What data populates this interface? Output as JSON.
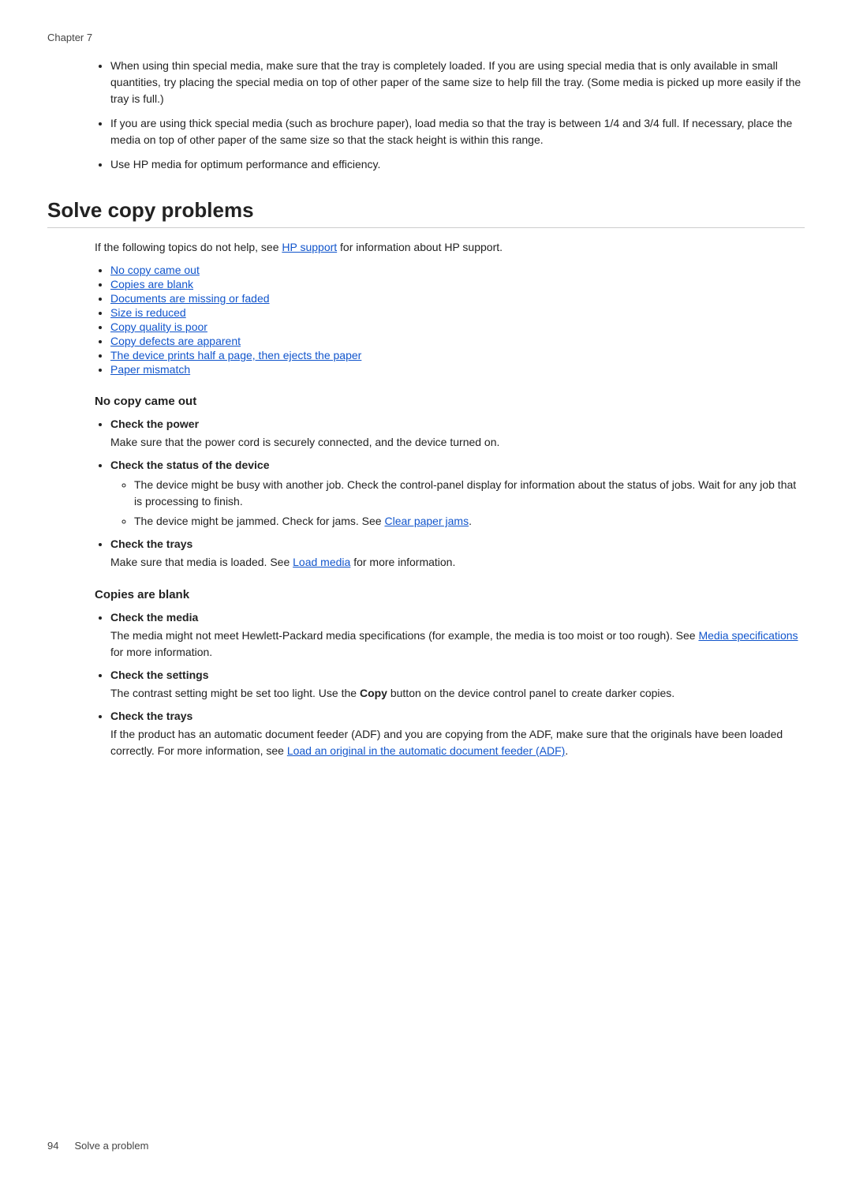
{
  "chapter": "Chapter 7",
  "intro_bullets": [
    "When using thin special media, make sure that the tray is completely loaded. If you are using special media that is only available in small quantities, try placing the special media on top of other paper of the same size to help fill the tray. (Some media is picked up more easily if the tray is full.)",
    "If you are using thick special media (such as brochure paper), load media so that the tray is between 1/4 and 3/4 full. If necessary, place the media on top of other paper of the same size so that the stack height is within this range.",
    "Use HP media for optimum performance and efficiency."
  ],
  "section_title": "Solve copy problems",
  "intro_text": "If the following topics do not help, see",
  "hp_support_link": "HP support",
  "intro_text2": "for information about HP support.",
  "toc_items": [
    {
      "label": "No copy came out",
      "href": "#no-copy"
    },
    {
      "label": "Copies are blank",
      "href": "#copies-blank"
    },
    {
      "label": "Documents are missing or faded",
      "href": "#docs-missing"
    },
    {
      "label": "Size is reduced",
      "href": "#size-reduced"
    },
    {
      "label": "Copy quality is poor",
      "href": "#copy-quality"
    },
    {
      "label": "Copy defects are apparent",
      "href": "#copy-defects"
    },
    {
      "label": "The device prints half a page, then ejects the paper",
      "href": "#half-page"
    },
    {
      "label": "Paper mismatch",
      "href": "#paper-mismatch"
    }
  ],
  "subsection_no_copy": {
    "title": "No copy came out",
    "bullets": [
      {
        "label": "Check the power",
        "body": "Make sure that the power cord is securely connected, and the device turned on.",
        "sub": []
      },
      {
        "label": "Check the status of the device",
        "body": "",
        "sub": [
          "The device might be busy with another job. Check the control-panel display for information about the status of jobs. Wait for any job that is processing to finish.",
          "The device might be jammed. Check for jams. See [Clear paper jams]."
        ]
      },
      {
        "label": "Check the trays",
        "body": "Make sure that media is loaded. See [Load media] for more information.",
        "sub": []
      }
    ]
  },
  "subsection_copies_blank": {
    "title": "Copies are blank",
    "bullets": [
      {
        "label": "Check the media",
        "body": "The media might not meet Hewlett-Packard media specifications (for example, the media is too moist or too rough). See [Media specifications] for more information.",
        "sub": []
      },
      {
        "label": "Check the settings",
        "body": "The contrast setting might be set too light. Use the Copy button on the device control panel to create darker copies.",
        "body_bold_word": "Copy",
        "sub": []
      },
      {
        "label": "Check the trays",
        "body": "If the product has an automatic document feeder (ADF) and you are copying from the ADF, make sure that the originals have been loaded correctly. For more information, see [Load an original in the automatic document feeder (ADF)].",
        "sub": []
      }
    ]
  },
  "footer": {
    "page_number": "94",
    "page_label": "Solve a problem"
  },
  "links": {
    "clear_paper_jams": "Clear paper jams",
    "load_media": "Load media",
    "media_specifications": "Media specifications",
    "load_adf": "Load an original in the automatic document feeder (ADF)"
  }
}
